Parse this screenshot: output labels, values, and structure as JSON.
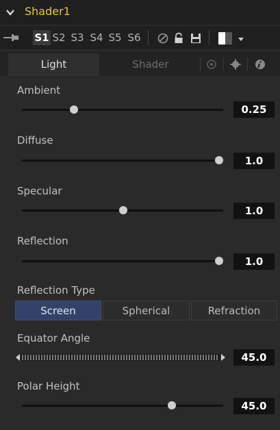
{
  "header": {
    "title": "Shader1"
  },
  "versions": [
    "S1",
    "S2",
    "S3",
    "S4",
    "S5",
    "S6"
  ],
  "active_version": "S1",
  "tabs": {
    "light": "Light",
    "shader": "Shader"
  },
  "controls": {
    "ambient": {
      "label": "Ambient",
      "value": "0.25",
      "level": 0.25
    },
    "diffuse": {
      "label": "Diffuse",
      "value": "1.0",
      "level": 1.0
    },
    "specular": {
      "label": "Specular",
      "value": "1.0",
      "level": 0.5
    },
    "reflection": {
      "label": "Reflection",
      "value": "1.0",
      "level": 1.0
    },
    "reflection_type": {
      "label": "Reflection Type",
      "options": [
        "Screen",
        "Spherical",
        "Refraction"
      ],
      "selected": "Screen"
    },
    "equator_angle": {
      "label": "Equator Angle",
      "value": "45.0"
    },
    "polar_height": {
      "label": "Polar Height",
      "value": "45.0",
      "level": 0.75
    }
  },
  "colors": {
    "title": "#e7c43a",
    "panel_bg": "#2a2a2a",
    "selected_button": "#34426a"
  },
  "icons": [
    "chevron-down-icon",
    "pin-icon",
    "no-entry-icon",
    "lock-icon",
    "save-icon",
    "color-swatch-icon",
    "dropdown-arrow-icon",
    "network-icon",
    "gear-icon",
    "info-icon"
  ]
}
